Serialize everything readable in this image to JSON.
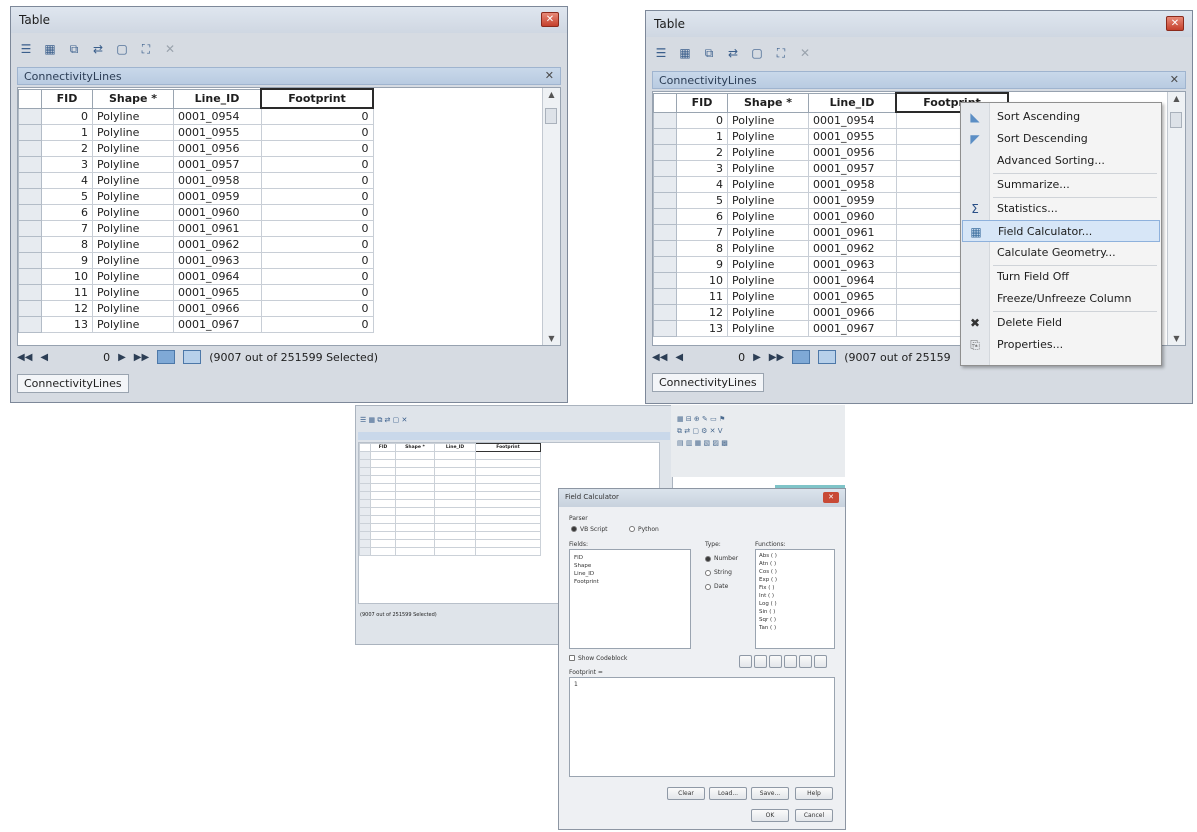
{
  "window1": {
    "title": "Table",
    "tab_label": "ConnectivityLines",
    "columns": [
      "FID",
      "Shape *",
      "Line_ID",
      "Footprint"
    ],
    "rows": [
      [
        "0",
        "Polyline",
        "0001_0954",
        "0"
      ],
      [
        "1",
        "Polyline",
        "0001_0955",
        "0"
      ],
      [
        "2",
        "Polyline",
        "0001_0956",
        "0"
      ],
      [
        "3",
        "Polyline",
        "0001_0957",
        "0"
      ],
      [
        "4",
        "Polyline",
        "0001_0958",
        "0"
      ],
      [
        "5",
        "Polyline",
        "0001_0959",
        "0"
      ],
      [
        "6",
        "Polyline",
        "0001_0960",
        "0"
      ],
      [
        "7",
        "Polyline",
        "0001_0961",
        "0"
      ],
      [
        "8",
        "Polyline",
        "0001_0962",
        "0"
      ],
      [
        "9",
        "Polyline",
        "0001_0963",
        "0"
      ],
      [
        "10",
        "Polyline",
        "0001_0964",
        "0"
      ],
      [
        "11",
        "Polyline",
        "0001_0965",
        "0"
      ],
      [
        "12",
        "Polyline",
        "0001_0966",
        "0"
      ],
      [
        "13",
        "Polyline",
        "0001_0967",
        "0"
      ]
    ],
    "nav_position": "0",
    "selection_status": "(9007 out of 251599 Selected)",
    "bottom_tab": "ConnectivityLines"
  },
  "window2": {
    "title": "Table",
    "tab_label": "ConnectivityLines",
    "columns": [
      "FID",
      "Shape *",
      "Line_ID",
      "Footprint"
    ],
    "rows": [
      [
        "0",
        "Polyline",
        "0001_0954"
      ],
      [
        "1",
        "Polyline",
        "0001_0955"
      ],
      [
        "2",
        "Polyline",
        "0001_0956"
      ],
      [
        "3",
        "Polyline",
        "0001_0957"
      ],
      [
        "4",
        "Polyline",
        "0001_0958"
      ],
      [
        "5",
        "Polyline",
        "0001_0959"
      ],
      [
        "6",
        "Polyline",
        "0001_0960"
      ],
      [
        "7",
        "Polyline",
        "0001_0961"
      ],
      [
        "8",
        "Polyline",
        "0001_0962"
      ],
      [
        "9",
        "Polyline",
        "0001_0963"
      ],
      [
        "10",
        "Polyline",
        "0001_0964"
      ],
      [
        "11",
        "Polyline",
        "0001_0965"
      ],
      [
        "12",
        "Polyline",
        "0001_0966"
      ],
      [
        "13",
        "Polyline",
        "0001_0967"
      ]
    ],
    "nav_position": "0",
    "selection_status": "(9007 out of 25159",
    "bottom_tab": "ConnectivityLines",
    "context_menu": {
      "items": [
        {
          "label": "Sort Ascending",
          "icon": "sort-ascending-icon"
        },
        {
          "label": "Sort Descending",
          "icon": "sort-descending-icon"
        },
        {
          "label": "Advanced Sorting...",
          "icon": ""
        },
        {
          "label": "Summarize...",
          "icon": ""
        },
        {
          "label": "Statistics...",
          "icon": "sigma-icon"
        },
        {
          "label": "Field Calculator...",
          "icon": "calculator-icon",
          "highlighted": true
        },
        {
          "label": "Calculate Geometry...",
          "icon": ""
        },
        {
          "label": "Turn Field Off",
          "icon": ""
        },
        {
          "label": "Freeze/Unfreeze Column",
          "icon": ""
        },
        {
          "label": "Delete Field",
          "icon": "delete-x-icon"
        },
        {
          "label": "Properties...",
          "icon": "properties-icon"
        }
      ]
    }
  },
  "window3": {
    "columns": [
      "FID",
      "Shape *",
      "Line_ID",
      "Footprint"
    ],
    "row_count": 13,
    "selection_status": "(9007 out of 251599 Selected)",
    "field_calculator": {
      "title": "Field Calculator",
      "parser_label": "Parser",
      "parser_vb": "VB Script",
      "parser_python": "Python",
      "fields_label": "Fields:",
      "fields": [
        "FID",
        "Shape",
        "Line_ID",
        "Footprint"
      ],
      "type_label": "Type:",
      "types": [
        "Number",
        "String",
        "Date"
      ],
      "functions_label": "Functions:",
      "functions": [
        "Abs ( )",
        "Atn ( )",
        "Cos ( )",
        "Exp ( )",
        "Fix ( )",
        "Int ( )",
        "Log ( )",
        "Sin ( )",
        "Sqr ( )",
        "Tan ( )"
      ],
      "show_codeblock": "Show Codeblock",
      "expression_label": "Footprint =",
      "expression_value": "1",
      "buttons": [
        "Clear",
        "Load...",
        "Save...",
        "Help"
      ],
      "ok": "OK",
      "cancel": "Cancel"
    }
  },
  "colors": {
    "window_bg": "#d6dbe2",
    "tab_header": "#c9d8ea",
    "menu_highlight": "#d7e6f7",
    "close_red": "#c5402c"
  }
}
